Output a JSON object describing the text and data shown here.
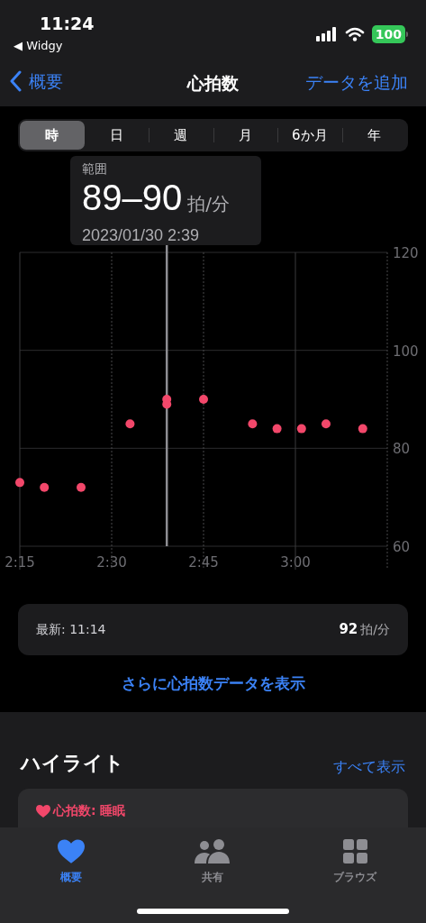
{
  "status_bar": {
    "time": "11:24",
    "back_app": "◀ Widgy",
    "battery": "100"
  },
  "nav": {
    "back": "概要",
    "title": "心拍数",
    "action": "データを追加"
  },
  "segments": [
    {
      "label": "時",
      "selected": true
    },
    {
      "label": "日",
      "selected": false
    },
    {
      "label": "週",
      "selected": false
    },
    {
      "label": "月",
      "selected": false
    },
    {
      "label": "6か月",
      "selected": false
    },
    {
      "label": "年",
      "selected": false
    }
  ],
  "tooltip": {
    "label": "範囲",
    "value": "89–90",
    "unit": "拍/分",
    "date": "2023/01/30 2:39"
  },
  "chart_data": {
    "type": "scatter",
    "x": [
      2.25,
      2.3167,
      2.4167,
      2.55,
      2.65,
      2.65,
      2.75,
      2.8833,
      2.95,
      3.0167,
      3.0833,
      3.1833
    ],
    "series": [
      {
        "color": "#f2476a",
        "values": [
          73,
          72,
          72,
          85,
          90,
          89,
          90,
          85,
          84,
          84,
          85,
          84
        ]
      }
    ],
    "xlim": [
      2.25,
      3.25
    ],
    "ylim": [
      60,
      120
    ],
    "xticks": [
      {
        "value": 2.25,
        "label": "2:15"
      },
      {
        "value": 2.5,
        "label": "2:30"
      },
      {
        "value": 2.75,
        "label": "2:45"
      },
      {
        "value": 3,
        "label": "3:00"
      }
    ],
    "yticks": [
      60,
      80,
      100,
      120
    ],
    "grid": true,
    "ref_lines": [
      {
        "axis": "x",
        "value": 2.65,
        "color": "#8e8e93"
      },
      {
        "axis": "x",
        "value": 3,
        "color": "#3a3a3c"
      }
    ]
  },
  "latest": {
    "label": "最新: 11:14",
    "value": "92",
    "unit": "拍/分"
  },
  "more_link": "さらに心拍数データを表示",
  "highlights": {
    "title": "ハイライト",
    "see_all": "すべて表示",
    "card_title": "心拍数: 睡眠"
  },
  "tab_bar": [
    {
      "kind": "heart",
      "label": "概要",
      "selected": true
    },
    {
      "kind": "people",
      "label": "共有",
      "selected": false
    },
    {
      "kind": "grid",
      "label": "ブラウズ",
      "selected": false
    }
  ]
}
